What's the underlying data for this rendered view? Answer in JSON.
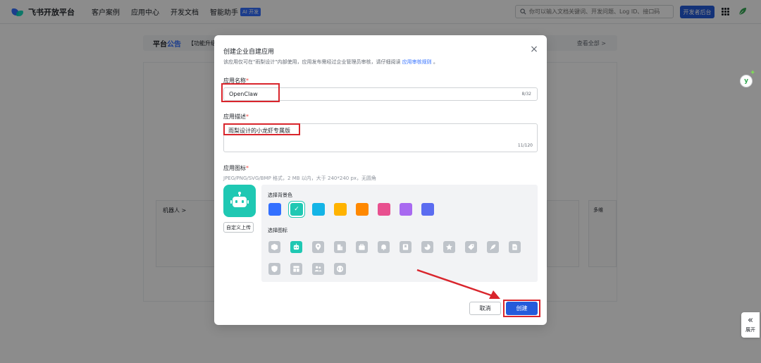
{
  "topnav": {
    "logo_text": "飞书开放平台",
    "links": [
      "客户案例",
      "应用中心",
      "开发文档",
      "智能助手"
    ],
    "ai_badge": "AI 开发",
    "search_placeholder": "你可以输入文档关键词、开发问题、Log ID、接口码",
    "dev_console_label": "开发者后台"
  },
  "background": {
    "panel_title_a": "平台",
    "panel_title_b": "公告",
    "panel_sub": "【功能升级",
    "panel_more": "查看全部 >",
    "robot_card_title": "机器人 >",
    "more_card_title": "多维"
  },
  "floating": {
    "assistant_letter": "y",
    "expand_label": "展开"
  },
  "modal": {
    "title": "创建企业自建应用",
    "desc_text": "该应用仅可在\"雨梨设计\"内部使用，应用发布需经过企业管理员审核，请仔细阅读",
    "desc_link": "应用审核规则",
    "desc_tail": "。",
    "name_label": "应用名称",
    "name_value": "OpenClaw",
    "name_count": "8/32",
    "desc_label": "应用描述",
    "desc_value": "雨梨设计的小龙虾专属版",
    "desc_count": "11/120",
    "icon_label": "应用图标",
    "icon_hint": "JPEG/PNG/SVG/BMP 格式，2 MB 以内，大于 240*240 px，无圆角",
    "upload_label": "自定义上传",
    "bg_color_label": "选择背景色",
    "icon_pick_label": "选择图标",
    "required_mark": "*",
    "cancel_label": "取消",
    "create_label": "创建"
  },
  "colors": {
    "swatches": [
      "#3370ff",
      "#1fc8b3",
      "#14b4e6",
      "#ffb300",
      "#ff8800",
      "#e8508f",
      "#a869f0",
      "#5b6cf0"
    ],
    "selected_swatch_index": 1,
    "accent": "#245bdb",
    "highlight_red": "#d9252c"
  },
  "icons": {
    "row1": [
      "cube-icon",
      "robot-icon",
      "location-pin-icon",
      "building-icon",
      "briefcase-icon",
      "bell-icon",
      "bookmark-icon",
      "pie-chart-icon",
      "star-icon",
      "tag-icon",
      "rocket-icon",
      "document-icon"
    ],
    "row2": [
      "shield-icon",
      "layout-icon",
      "group-icon",
      "code-icon"
    ],
    "selected_index": 1
  }
}
